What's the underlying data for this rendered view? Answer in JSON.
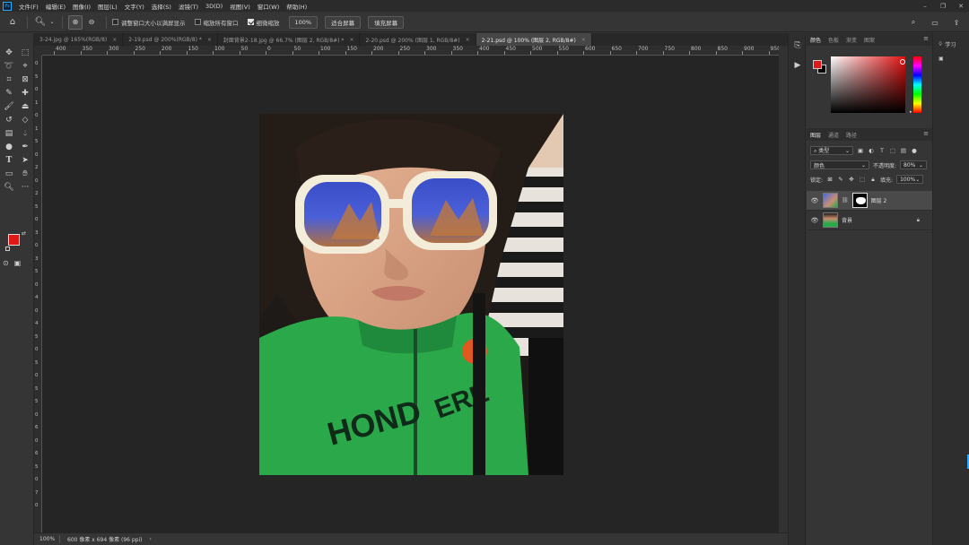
{
  "menubar": {
    "app_logo": "Ps",
    "items": [
      "文件(F)",
      "编辑(E)",
      "图像(I)",
      "图层(L)",
      "文字(Y)",
      "选择(S)",
      "滤镜(T)",
      "3D(D)",
      "视图(V)",
      "窗口(W)",
      "帮助(H)"
    ],
    "window_controls": [
      "–",
      "❐",
      "✕"
    ]
  },
  "options": {
    "resize_windows_label": "调整窗口大小以满屏显示",
    "zoom_all_label": "缩放所有窗口",
    "scrubby_zoom_label": "细微缩放",
    "resize_checked": false,
    "zoom_all_checked": false,
    "scrubby_checked": true,
    "zoom_100_label": "100%",
    "fit_screen_label": "适合屏幕",
    "fill_screen_label": "填充屏幕"
  },
  "tabs": [
    {
      "label": "3-24.jpg @ 165%(RGB/8)",
      "active": false
    },
    {
      "label": "2-19.psd @ 200%(RGB/8) *",
      "active": false
    },
    {
      "label": "封面背景2-18.jpg @ 66.7% (图层 2, RGB/8#) *",
      "active": false
    },
    {
      "label": "2-20.psd @ 200% (图层 1, RGB/8#)",
      "active": false
    },
    {
      "label": "2-21.psd @ 100% (图层 2, RGB/8#)",
      "active": true
    }
  ],
  "ruler_top": [
    "400",
    "350",
    "300",
    "250",
    "200",
    "150",
    "100",
    "50",
    "0",
    "50",
    "100",
    "150",
    "200",
    "250",
    "300",
    "350",
    "400",
    "450",
    "500",
    "550",
    "600",
    "650",
    "700",
    "750",
    "800",
    "850",
    "900",
    "950"
  ],
  "ruler_left": [
    "0",
    "5",
    "0",
    "1",
    "0",
    "1",
    "5",
    "0",
    "2",
    "0",
    "2",
    "5",
    "0",
    "3",
    "0",
    "3",
    "5",
    "0",
    "4",
    "0",
    "4",
    "5",
    "0",
    "5",
    "0",
    "5",
    "5",
    "0",
    "6",
    "0",
    "6",
    "5",
    "0",
    "7",
    "0"
  ],
  "status": {
    "zoom": "100%",
    "doc_info": "600 像素 x 694 像素 (96 ppi)",
    "arrow": "›"
  },
  "color_panel": {
    "tabs": [
      "颜色",
      "色板",
      "渐变",
      "图案"
    ],
    "active_tab": 0,
    "foreground": "#e11818",
    "background": "#000000"
  },
  "layers_panel": {
    "tabs": [
      "图层",
      "通道",
      "路径"
    ],
    "active_tab": 0,
    "filter_label": "类型",
    "blend_mode": "颜色",
    "opacity_label": "不透明度:",
    "opacity_value": "80%",
    "lock_label": "锁定:",
    "fill_label": "填充:",
    "fill_value": "100%",
    "layers": [
      {
        "name": "图层 2",
        "visible": true,
        "selected": true,
        "has_mask": true
      },
      {
        "name": "背景",
        "visible": true,
        "selected": false,
        "locked": true
      }
    ]
  },
  "learn_panel": {
    "learn_label": "学习"
  }
}
